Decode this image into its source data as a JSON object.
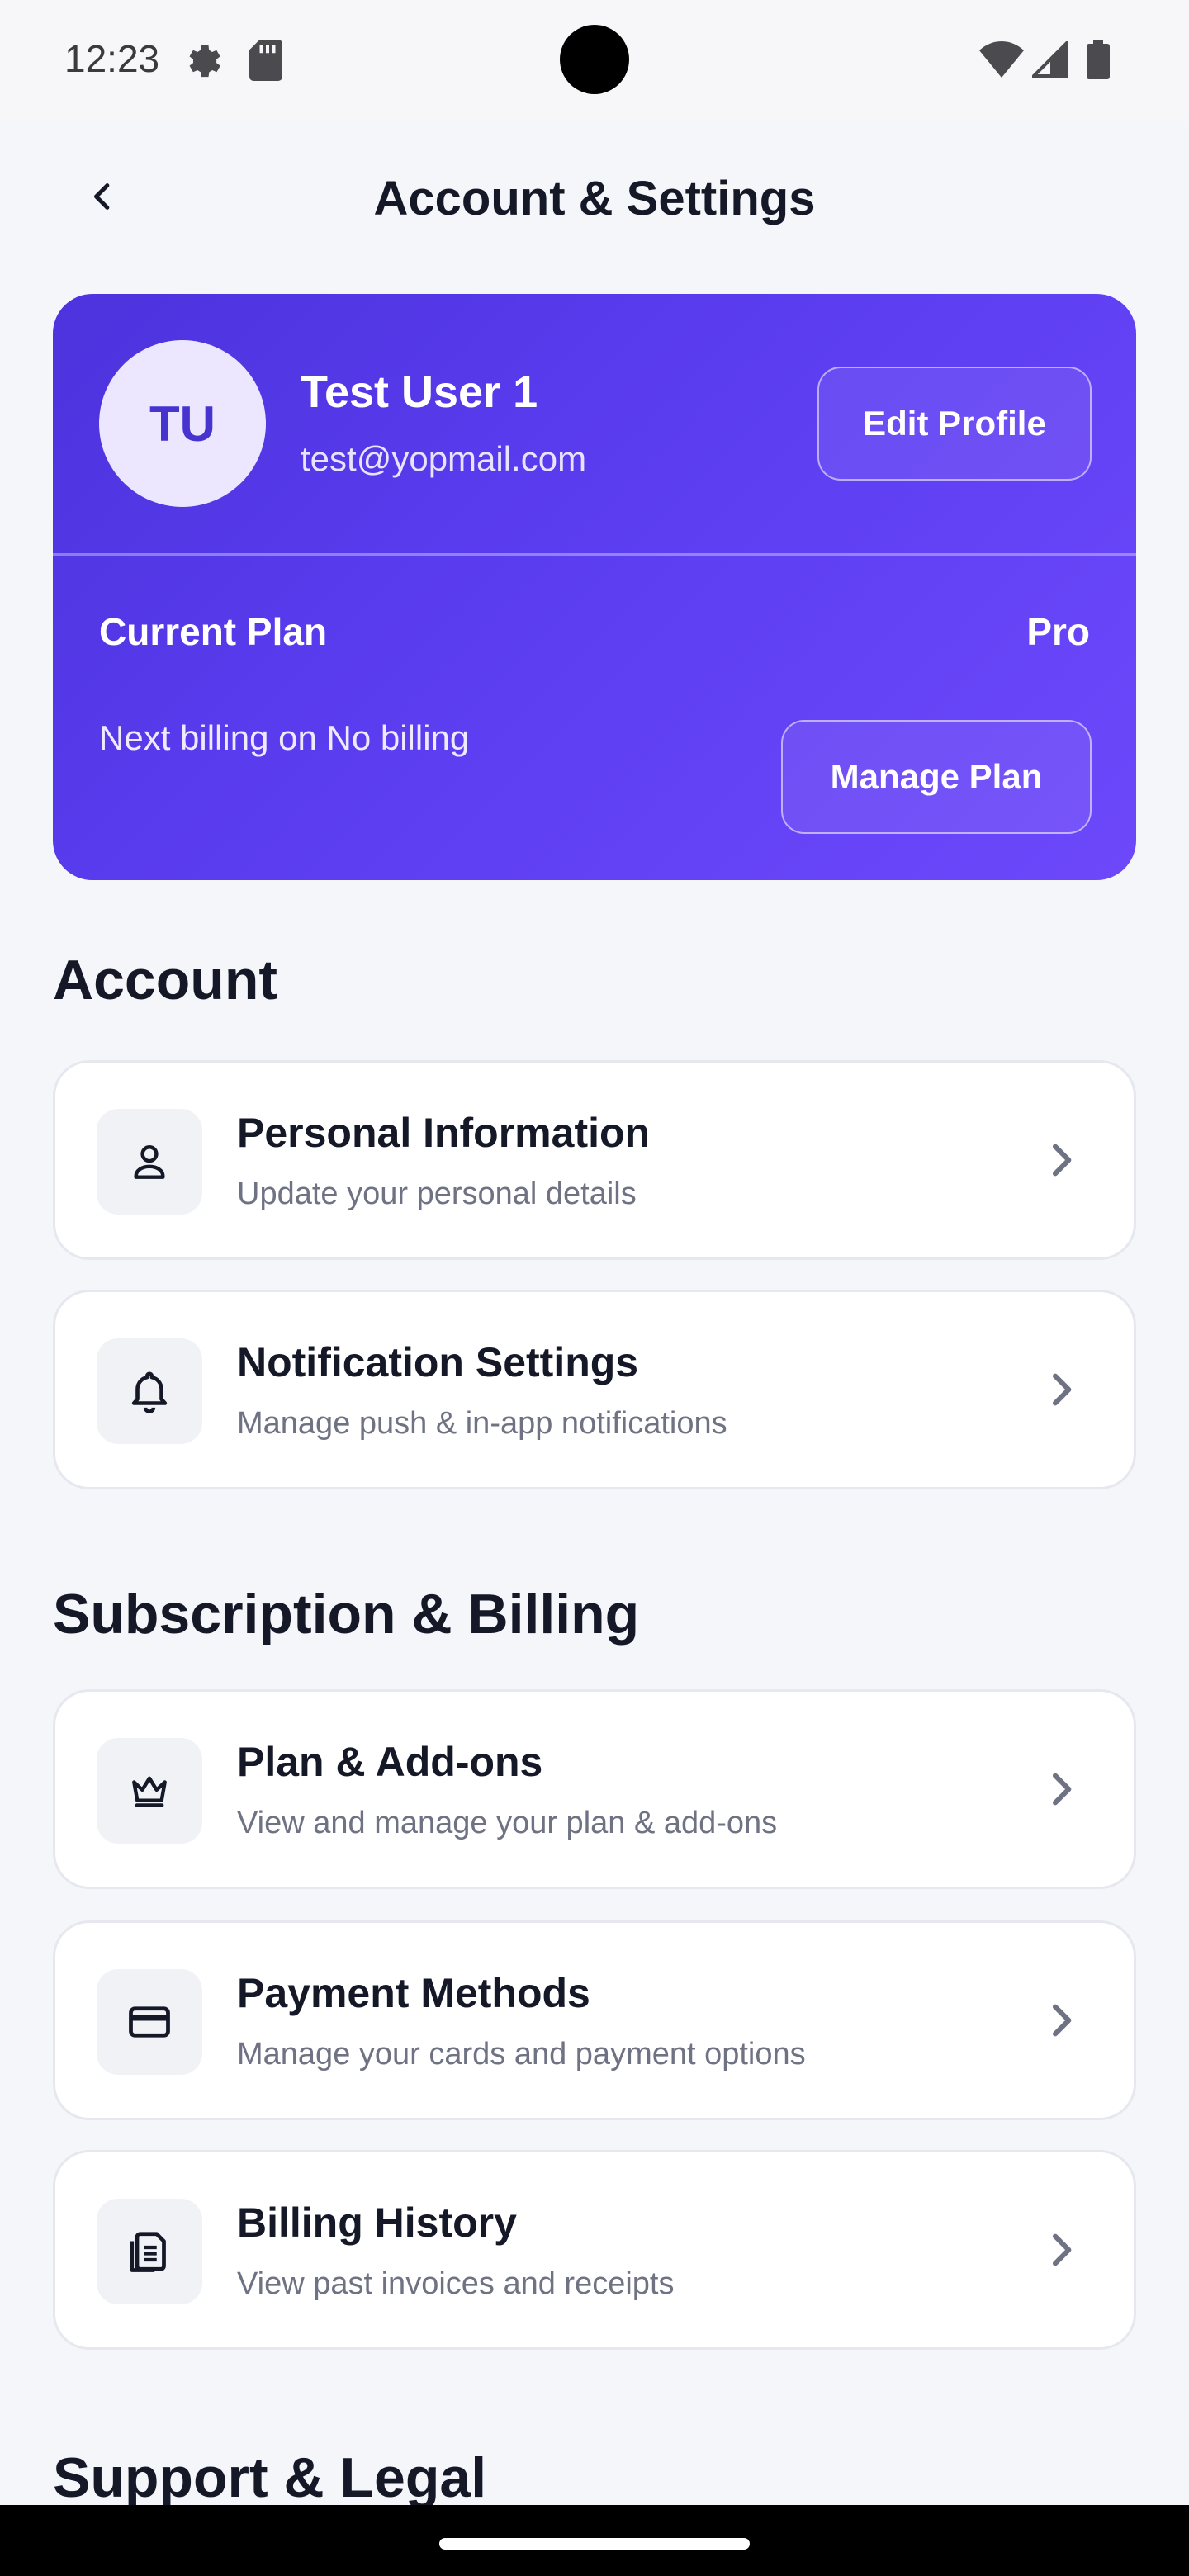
{
  "status_bar": {
    "time": "12:23"
  },
  "header": {
    "title": "Account & Settings"
  },
  "profile": {
    "initials": "TU",
    "name": "Test User 1",
    "email": "test@yopmail.com",
    "edit_label": "Edit Profile",
    "plan_label": "Current Plan",
    "plan_value": "Pro",
    "billing_text": "Next billing on No billing",
    "manage_label": "Manage Plan"
  },
  "sections": {
    "account": {
      "title": "Account",
      "items": [
        {
          "title": "Personal Information",
          "subtitle": "Update your personal details",
          "icon": "person-icon"
        },
        {
          "title": "Notification Settings",
          "subtitle": "Manage push & in-app notifications",
          "icon": "bell-icon"
        }
      ]
    },
    "billing": {
      "title": "Subscription & Billing",
      "items": [
        {
          "title": "Plan & Add-ons",
          "subtitle": "View and manage your plan & add-ons",
          "icon": "crown-icon"
        },
        {
          "title": "Payment Methods",
          "subtitle": "Manage your cards and payment options",
          "icon": "credit-card-icon"
        },
        {
          "title": "Billing History",
          "subtitle": "View past invoices and receipts",
          "icon": "document-icon"
        }
      ]
    },
    "support": {
      "title": "Support & Legal"
    }
  },
  "colors": {
    "card_gradient_start": "#4c33dd",
    "card_gradient_end": "#6d48fb",
    "background": "#f5f6fa",
    "text_primary": "#141827",
    "text_secondary": "#6e7283"
  }
}
